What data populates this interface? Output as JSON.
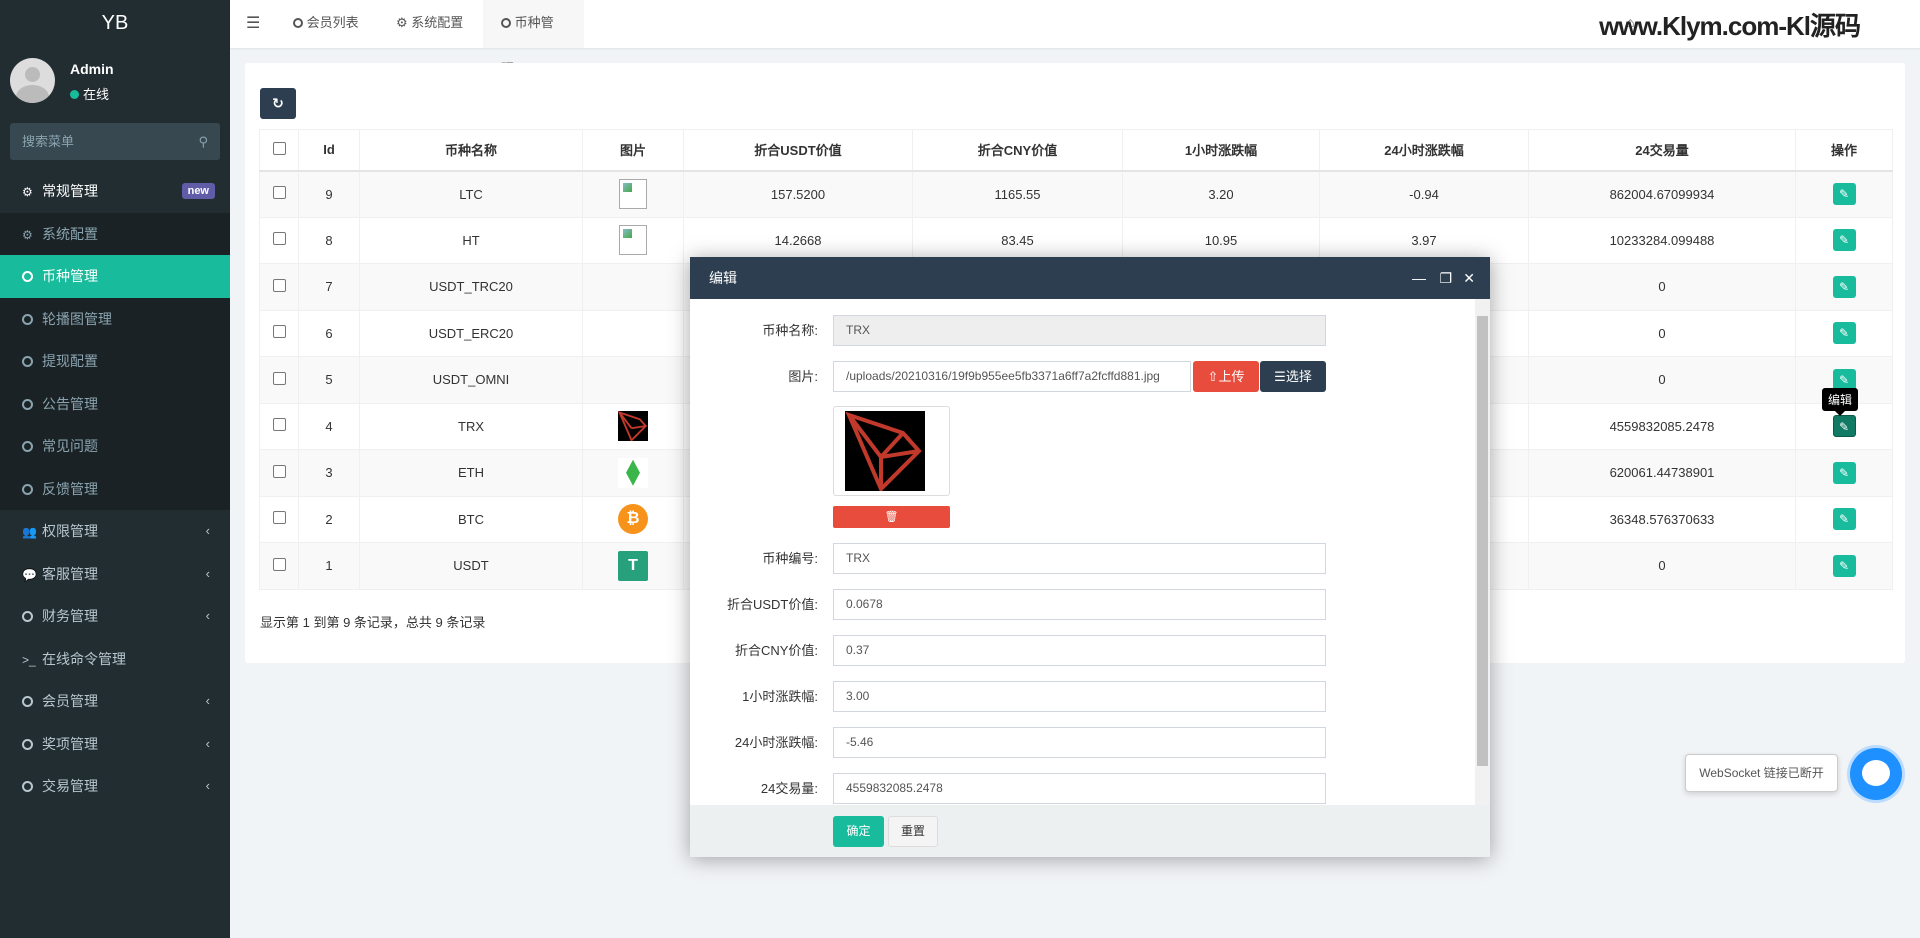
{
  "sidebar": {
    "logo": "YB",
    "user": {
      "name": "Admin",
      "status": "在线"
    },
    "search_placeholder": "搜索菜单",
    "groups": [
      {
        "label": "常规管理",
        "badge": "new"
      },
      {
        "label": "系统配置"
      },
      {
        "label": "币种管理"
      },
      {
        "label": "轮播图管理"
      },
      {
        "label": "提现配置"
      },
      {
        "label": "公告管理"
      },
      {
        "label": "常见问题"
      },
      {
        "label": "反馈管理"
      },
      {
        "label": "权限管理"
      },
      {
        "label": "客服管理"
      },
      {
        "label": "财务管理"
      },
      {
        "label": "在线命令管理"
      },
      {
        "label": "会员管理"
      },
      {
        "label": "奖项管理"
      },
      {
        "label": "交易管理"
      }
    ]
  },
  "topbar": {
    "tabs": [
      {
        "label": "会员列表"
      },
      {
        "label": "系统配置"
      },
      {
        "label": "币种管理"
      }
    ],
    "watermark": "www.Klym.com-Kl源码"
  },
  "table": {
    "columns": [
      "Id",
      "币种名称",
      "图片",
      "折合USDT价值",
      "折合CNY价值",
      "1小时涨跌幅",
      "24小时涨跌幅",
      "24交易量",
      "操作"
    ],
    "rows": [
      {
        "id": "9",
        "name": "LTC",
        "img": "broken",
        "usdt": "157.5200",
        "cny": "1165.55",
        "h1": "3.20",
        "h24": "-0.94",
        "vol": "862004.67099934"
      },
      {
        "id": "8",
        "name": "HT",
        "img": "broken",
        "usdt": "14.2668",
        "cny": "83.45",
        "h1": "10.95",
        "h24": "3.97",
        "vol": "10233284.099488"
      },
      {
        "id": "7",
        "name": "USDT_TRC20",
        "img": "",
        "usdt": "",
        "cny": "",
        "h1": "",
        "h24": "",
        "vol": "0"
      },
      {
        "id": "6",
        "name": "USDT_ERC20",
        "img": "",
        "usdt": "",
        "cny": "",
        "h1": "",
        "h24": "",
        "vol": "0"
      },
      {
        "id": "5",
        "name": "USDT_OMNI",
        "img": "",
        "usdt": "",
        "cny": "",
        "h1": "",
        "h24": "",
        "vol": "0"
      },
      {
        "id": "4",
        "name": "TRX",
        "img": "trx",
        "usdt": "",
        "cny": "",
        "h1": "",
        "h24": "",
        "vol": "4559832085.2478"
      },
      {
        "id": "3",
        "name": "ETH",
        "img": "eth",
        "usdt": "",
        "cny": "",
        "h1": "",
        "h24": "",
        "vol": "620061.44738901"
      },
      {
        "id": "2",
        "name": "BTC",
        "img": "btc",
        "usdt": "",
        "cny": "",
        "h1": "",
        "h24": "",
        "vol": "36348.576370633"
      },
      {
        "id": "1",
        "name": "USDT",
        "img": "usdt",
        "usdt": "",
        "cny": "",
        "h1": "",
        "h24": "",
        "vol": "0"
      }
    ],
    "tooltip": "编辑",
    "footer": "显示第 1 到第 9 条记录，总共 9 条记录"
  },
  "modal": {
    "title": "编辑",
    "fields": {
      "name": {
        "label": "币种名称:",
        "value": "TRX"
      },
      "image": {
        "label": "图片:",
        "value": "/uploads/20210316/19f9b955ee5fb3371a6ff7a2fcffd881.jpg",
        "upload": "上传",
        "select": "选择"
      },
      "code": {
        "label": "币种编号:",
        "value": "TRX"
      },
      "usdt": {
        "label": "折合USDT价值:",
        "value": "0.0678"
      },
      "cny": {
        "label": "折合CNY价值:",
        "value": "0.37"
      },
      "h1": {
        "label": "1小时涨跌幅:",
        "value": "3.00"
      },
      "h24": {
        "label": "24小时涨跌幅:",
        "value": "-5.46"
      },
      "vol": {
        "label": "24交易量:",
        "value": "4559832085.2478"
      }
    },
    "ok": "确定",
    "reset": "重置"
  },
  "websocket": {
    "message": "WebSocket 链接已断开"
  },
  "colors": {
    "accent": "#18bc9c",
    "dark": "#2c3e50",
    "danger": "#e74c3c",
    "sidebar": "#222d32"
  }
}
